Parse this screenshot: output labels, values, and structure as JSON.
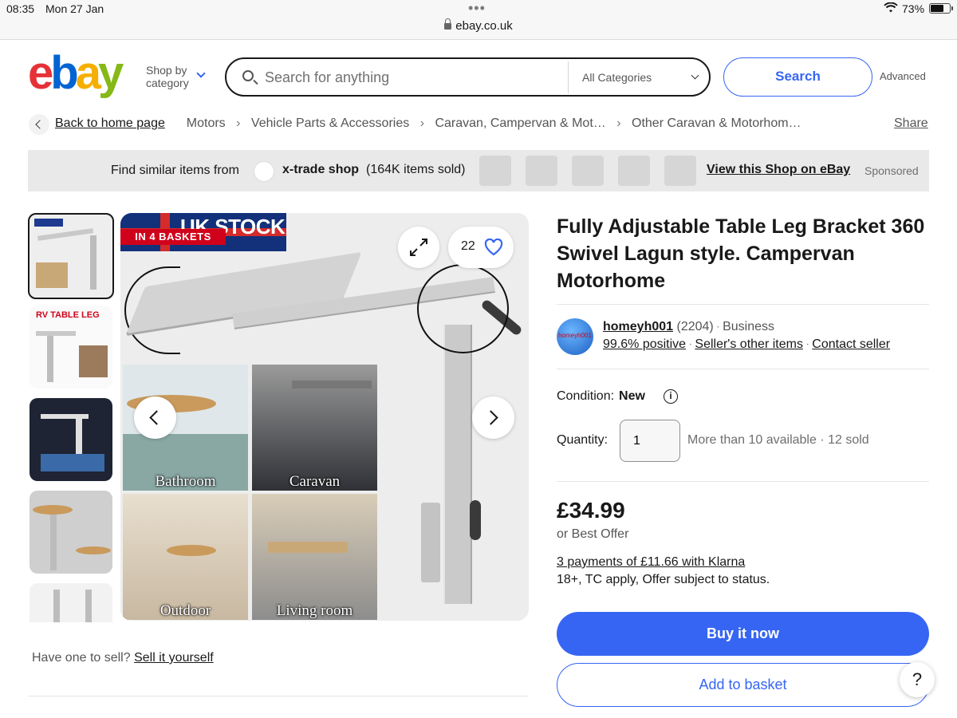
{
  "status_bar": {
    "time": "08:35",
    "date": "Mon 27 Jan",
    "url": "ebay.co.uk",
    "battery": "73%"
  },
  "header": {
    "logo": {
      "e": "e",
      "b": "b",
      "a": "a",
      "y": "y"
    },
    "shop_by_line1": "Shop by",
    "shop_by_line2": "category",
    "search_placeholder": "Search for anything",
    "category_select": "All Categories",
    "search_button": "Search",
    "advanced": "Advanced"
  },
  "breadcrumbs": {
    "back": "Back to home page",
    "items": [
      "Motors",
      "Vehicle Parts & Accessories",
      "Caravan, Campervan & Mot…",
      "Other Caravan & Motorhom…"
    ],
    "share": "Share"
  },
  "banner": {
    "find_text": "Find similar items from",
    "shop_name": "x-trade shop",
    "sold": "(164K items sold)",
    "view_shop": "View this Shop on eBay",
    "sponsored": "Sponsored"
  },
  "gallery": {
    "thumb_rv_label": "RV TABLE LEG",
    "badge_stock": "UK STOCK",
    "badge_baskets": "IN 4 BASKETS",
    "watchers": "22",
    "captions": [
      "Bathroom",
      "Caravan",
      "Outdoor",
      "Living room"
    ]
  },
  "sell": {
    "question": "Have one to sell?",
    "link": "Sell it yourself"
  },
  "listing": {
    "title": "Fully Adjustable Table Leg Bracket 360 Swivel Lagun style. Campervan Motorhome",
    "seller": {
      "avatar_text": "homeyh001",
      "name": "homeyh001",
      "feedback": "(2204)",
      "type": "Business",
      "positive": "99.6% positive",
      "other_items": "Seller's other items",
      "contact": "Contact seller"
    },
    "condition_label": "Condition:",
    "condition_value": "New",
    "quantity_label": "Quantity:",
    "quantity_value": "1",
    "availability": "More than 10 available · 12 sold",
    "price": "£34.99",
    "best_offer": "or Best Offer",
    "klarna": "3 payments of £11.66 with Klarna",
    "klarna_note": "18+, TC apply, Offer subject to status.",
    "buy_now": "Buy it now",
    "add_to_basket": "Add to basket",
    "help": "?"
  },
  "colors": {
    "accent": "#3665f3",
    "logo_e": "#e53238",
    "logo_b": "#0064d2",
    "logo_a": "#f5af02",
    "logo_y": "#86b817"
  }
}
